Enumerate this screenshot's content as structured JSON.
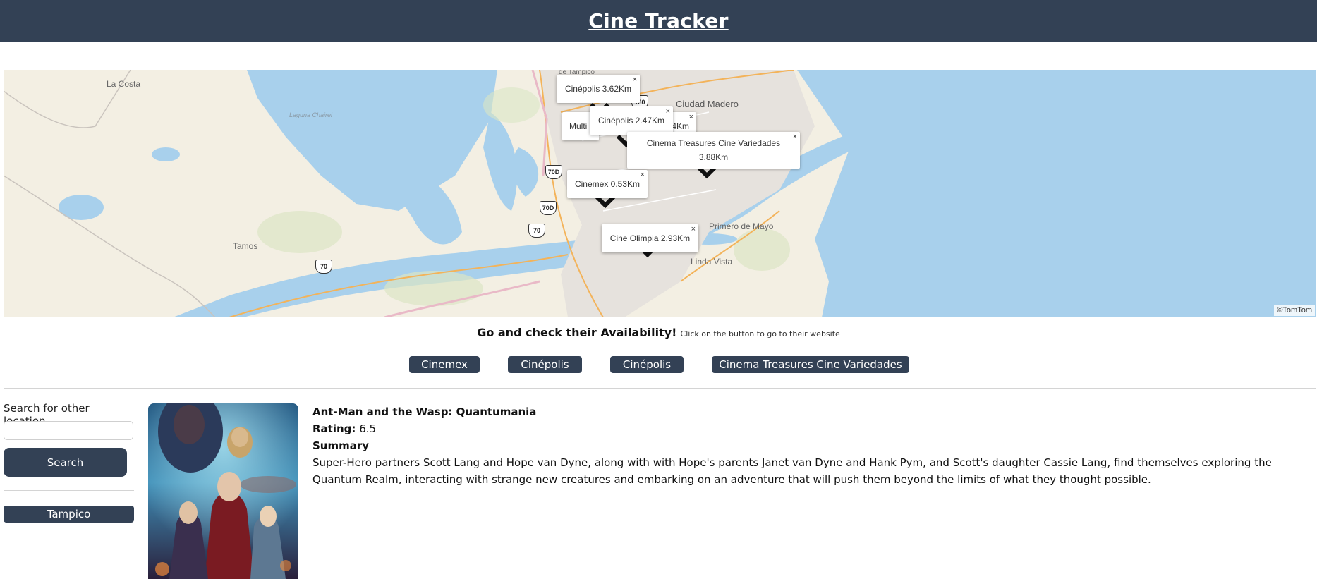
{
  "header": {
    "title": "Cine Tracker"
  },
  "map": {
    "credit": "©TomTom",
    "place_labels": [
      "La Costa",
      "Laguna Chairel",
      "Ciudad Madero",
      "Tamos",
      "Primero de Mayo",
      "Linda Vista",
      "de Tampico"
    ],
    "road_shields": [
      "180",
      "70D",
      "70D",
      "70",
      "70"
    ],
    "popups": [
      {
        "label": "Cinépolis 3.62Km",
        "close": "×"
      },
      {
        "label": "Multi",
        "close": ""
      },
      {
        "label": "Cinépolis 2.47Km",
        "close": "×"
      },
      {
        "label": "4Km",
        "close": "×"
      },
      {
        "label": "Cinema Treasures Cine Variedades 3.88Km",
        "close": "×"
      },
      {
        "label": "Cinemex 0.53Km",
        "close": "×"
      },
      {
        "label": "Cine Olimpia 2.93Km",
        "close": "×"
      }
    ]
  },
  "availability": {
    "headline": "Go and check their Availability!",
    "hint": "Click on the button to go to their website"
  },
  "cinema_buttons": [
    "Cinemex",
    "Cinépolis",
    "Cinépolis",
    "Cinema Treasures Cine Variedades"
  ],
  "sidebar": {
    "search_label": "Search for other location",
    "search_value": "",
    "search_button": "Search",
    "location_button": "Tampico"
  },
  "movie": {
    "title": "Ant-Man and the Wasp: Quantumania",
    "rating_label": "Rating:",
    "rating_value": "6.5",
    "summary_label": "Summary",
    "summary": "Super-Hero partners Scott Lang and Hope van Dyne, along with with Hope's parents Janet van Dyne and Hank Pym, and Scott's daughter Cassie Lang, find themselves exploring the Quantum Realm, interacting with strange new creatures and embarking on an adventure that will push them beyond the limits of what they thought possible."
  },
  "colors": {
    "header": "#334155",
    "button": "#334155",
    "water": "#a8d0ec",
    "land": "#f3efe3"
  }
}
